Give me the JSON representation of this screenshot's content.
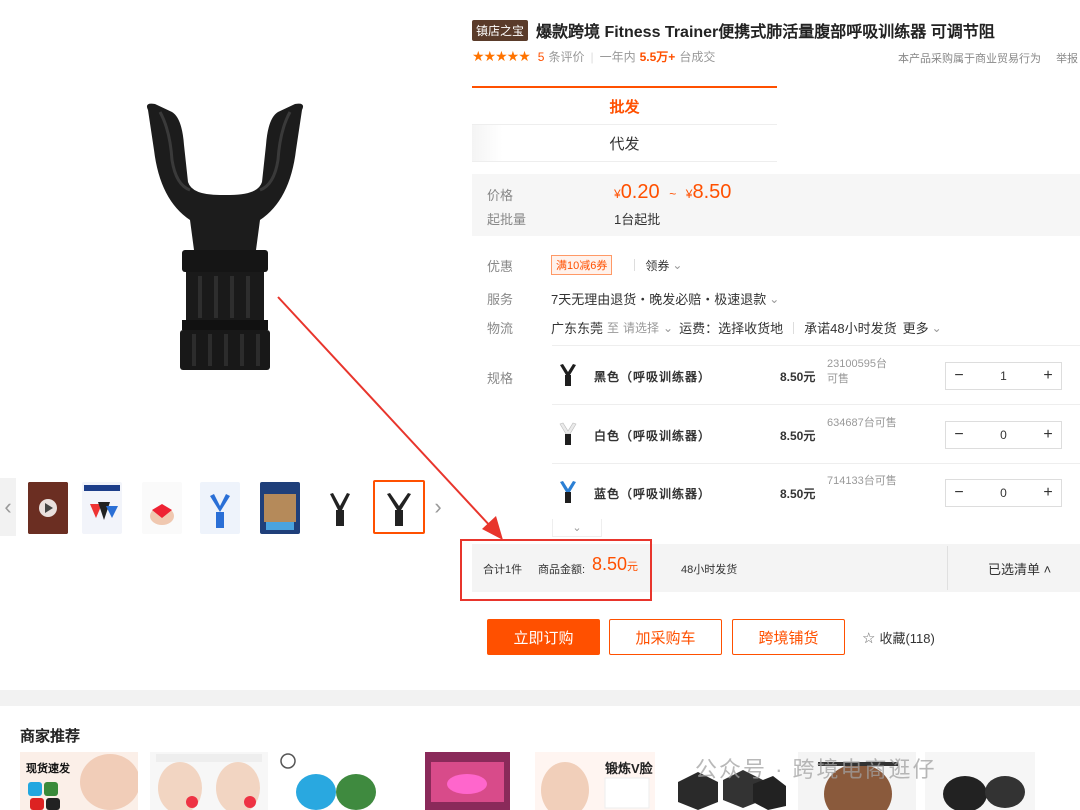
{
  "product": {
    "shop_badge": "镇店之宝",
    "title": "爆款跨境 Fitness Trainer便携式肺活量腹部呼吸训练器 可调节阻",
    "stars": "★★★★★",
    "review_count": "5",
    "review_suffix": "条评价",
    "sales_prefix": "一年内",
    "sales_value": "5.5万+",
    "sales_suffix": "台成交",
    "report_note": "本产品采购属于商业贸易行为",
    "report_link": "举报"
  },
  "mode_tabs": [
    {
      "label": "批发"
    },
    {
      "label": "代发"
    }
  ],
  "price": {
    "label": "价格",
    "currency": "¥",
    "low": "0.20",
    "tilde": "~",
    "high": "8.50",
    "moq_label": "起批量",
    "moq_value": "1台起批"
  },
  "discount": {
    "label": "优惠",
    "coupon": "满10减6券",
    "claim": "领券"
  },
  "service": {
    "label": "服务",
    "value": "7天无理由退货・晚发必赔・极速退款"
  },
  "logistics": {
    "label": "物流",
    "origin": "广东东莞",
    "to": "至",
    "select": "请选择",
    "freight": "运费：选择收货地",
    "promise": "承诺48小时发货",
    "more": "更多"
  },
  "spec": {
    "label": "规格",
    "items": [
      {
        "name": "黑色（呼吸训练器）",
        "price": "8.50元",
        "stock": "23100595台可售",
        "qty": "1",
        "color": "#1e1e1e"
      },
      {
        "name": "白色（呼吸训练器）",
        "price": "8.50元",
        "stock": "634687台可售",
        "qty": "0",
        "color": "#1e1e1e"
      },
      {
        "name": "蓝色（呼吸训练器）",
        "price": "8.50元",
        "stock": "714133台可售",
        "qty": "0",
        "color": "#2b7fd4"
      }
    ],
    "minus": "−",
    "plus": "+"
  },
  "summary": {
    "count": "合计1件",
    "amount_label": "商品金额:",
    "amount": "8.50",
    "amount_unit": "元",
    "ship": "48小时发货",
    "selected_list": "已选清单 ˄"
  },
  "actions": {
    "order": "立即订购",
    "cart": "加采购车",
    "crossborder": "跨境铺货",
    "favorite": "收藏(118)"
  },
  "recommend": {
    "title": "商家推荐",
    "item1_text": "现货速发",
    "item5_text": "锻炼V脸",
    "watermark": "公众号 · 跨境电商逛仔"
  },
  "colors": {
    "accent": "#ff5000",
    "annotation": "#e8352c",
    "shop_badge": "#5a3b2a"
  }
}
